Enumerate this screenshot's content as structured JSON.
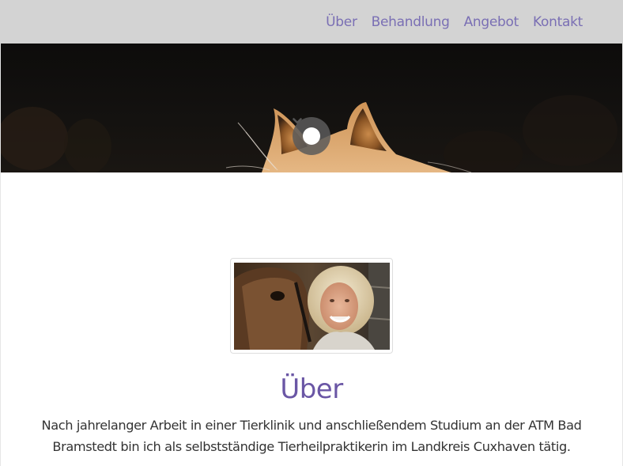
{
  "nav": {
    "items": [
      {
        "label": "Über"
      },
      {
        "label": "Behandlung"
      },
      {
        "label": "Angebot"
      },
      {
        "label": "Kontakt"
      }
    ],
    "link_color": "#7a6fb4",
    "background": "#d3d3d3"
  },
  "hero": {
    "scroll_icon": "chevron-down-icon"
  },
  "about": {
    "title": "Über",
    "text": "Nach jahrelanger Arbeit in einer Tierklinik und anschließendem Studium an der ATM Bad Bramstedt bin ich als selbstständige Tierheilpraktikerin im Landkreis Cuxhaven tätig.",
    "title_color": "#6a56a5"
  }
}
